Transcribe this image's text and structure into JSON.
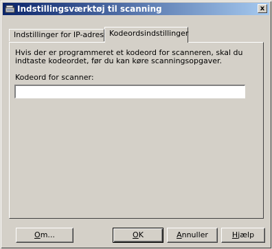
{
  "window": {
    "title": "Indstillingsværktøj til scanning",
    "close_label": "x"
  },
  "tabs": [
    {
      "label": "Indstillinger for IP-adresse",
      "active": false
    },
    {
      "label": "Kodeordsindstillinger",
      "active": true
    }
  ],
  "panel": {
    "description": "Hvis der er programmeret et kodeord for scanneren, skal du indtaste kodeordet, før du kan køre scanningsopgaver.",
    "password_label": "Kodeord for scanner:",
    "password_value": ""
  },
  "buttons": {
    "about": {
      "mnemonic": "O",
      "rest": "m..."
    },
    "ok": {
      "mnemonic": "O",
      "rest": "K"
    },
    "cancel": {
      "mnemonic": "A",
      "rest": "nnuller"
    },
    "help": {
      "mnemonic": "H",
      "rest": "jælp"
    }
  },
  "colors": {
    "face": "#d4d0c8",
    "title_start": "#0a246a",
    "title_end": "#a6caf0"
  },
  "icons": {
    "title": "scanner-icon",
    "close": "close-icon"
  }
}
